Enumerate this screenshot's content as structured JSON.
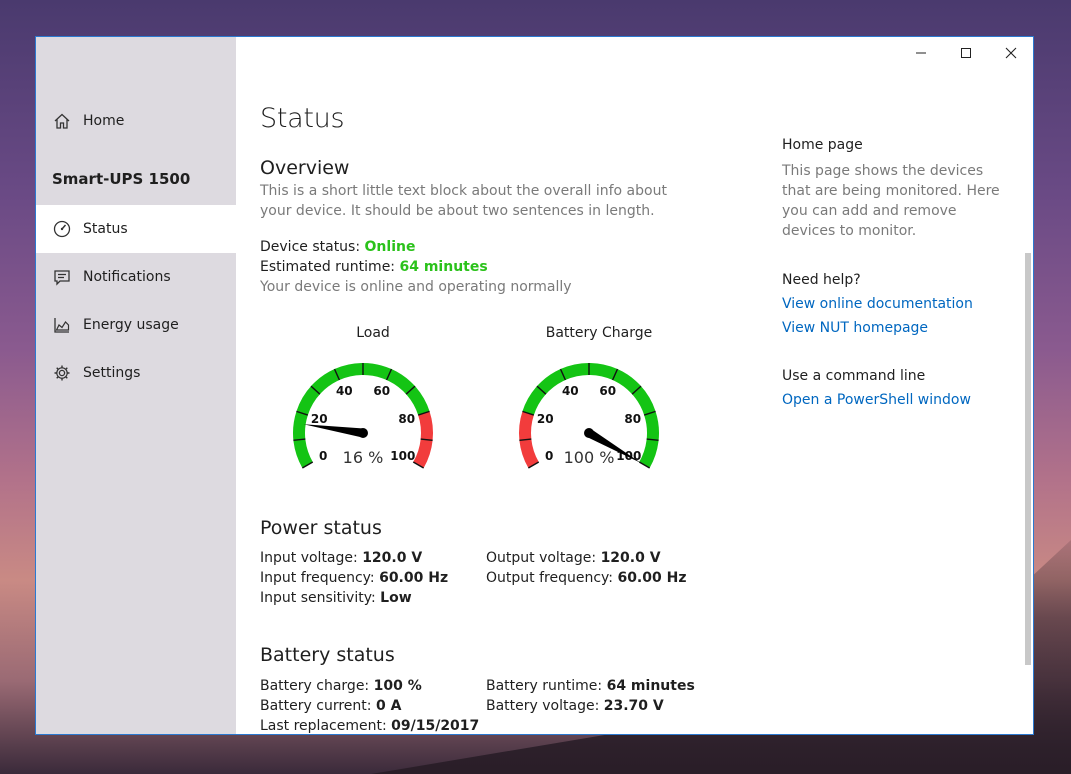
{
  "window": {
    "minimize_glyph": "—",
    "maximize_glyph": "☐",
    "close_glyph": "✕"
  },
  "sidebar": {
    "home_label": "Home",
    "device_name": "Smart-UPS 1500",
    "items": [
      {
        "label": "Status",
        "icon": "gauge-icon"
      },
      {
        "label": "Notifications",
        "icon": "message-icon"
      },
      {
        "label": "Energy usage",
        "icon": "area-chart-icon"
      },
      {
        "label": "Settings",
        "icon": "gear-icon"
      }
    ]
  },
  "main": {
    "title": "Status",
    "overview": {
      "heading": "Overview",
      "description": "This is a short little text block about the overall info about your device. It should be about two sentences in length.",
      "device_status_label": "Device status:",
      "device_status_value": "Online",
      "runtime_label": "Estimated runtime:",
      "runtime_value": "64 minutes",
      "status_message": "Your device is online and operating normally"
    },
    "gauges": [
      {
        "title": "Load",
        "value": 16,
        "display": "16 %",
        "ticks": [
          "0",
          "20",
          "40",
          "60",
          "80",
          "100"
        ],
        "red_zone": "high"
      },
      {
        "title": "Battery Charge",
        "value": 100,
        "display": "100 %",
        "ticks": [
          "0",
          "20",
          "40",
          "60",
          "80",
          "100"
        ],
        "red_zone": "low"
      }
    ],
    "power_status": {
      "heading": "Power status",
      "input_voltage_label": "Input voltage:",
      "input_voltage_value": "120.0 V",
      "input_frequency_label": "Input frequency:",
      "input_frequency_value": "60.00 Hz",
      "input_sensitivity_label": "Input sensitivity:",
      "input_sensitivity_value": "Low",
      "output_voltage_label": "Output voltage:",
      "output_voltage_value": "120.0 V",
      "output_frequency_label": "Output frequency:",
      "output_frequency_value": "60.00 Hz"
    },
    "battery_status": {
      "heading": "Battery status",
      "charge_label": "Battery charge:",
      "charge_value": "100 %",
      "current_label": "Battery current:",
      "current_value": "0 A",
      "replacement_label": "Last replacement:",
      "replacement_value": "09/15/2017",
      "runtime_label": "Battery runtime:",
      "runtime_value": "64 minutes",
      "voltage_label": "Battery voltage:",
      "voltage_value": "23.70 V"
    }
  },
  "right_panel": {
    "home_page_heading": "Home page",
    "home_page_text": "This page shows the devices that are being monitored. Here you can add and remove devices to monitor.",
    "help_heading": "Need help?",
    "link_docs": "View online documentation",
    "link_nut": "View NUT homepage",
    "cmd_heading": "Use a command line",
    "link_powershell": "Open a PowerShell window"
  },
  "colors": {
    "accent_green": "#2bc21b",
    "gauge_green": "#14c414",
    "gauge_red": "#f23c3c",
    "link_blue": "#0067c0"
  }
}
